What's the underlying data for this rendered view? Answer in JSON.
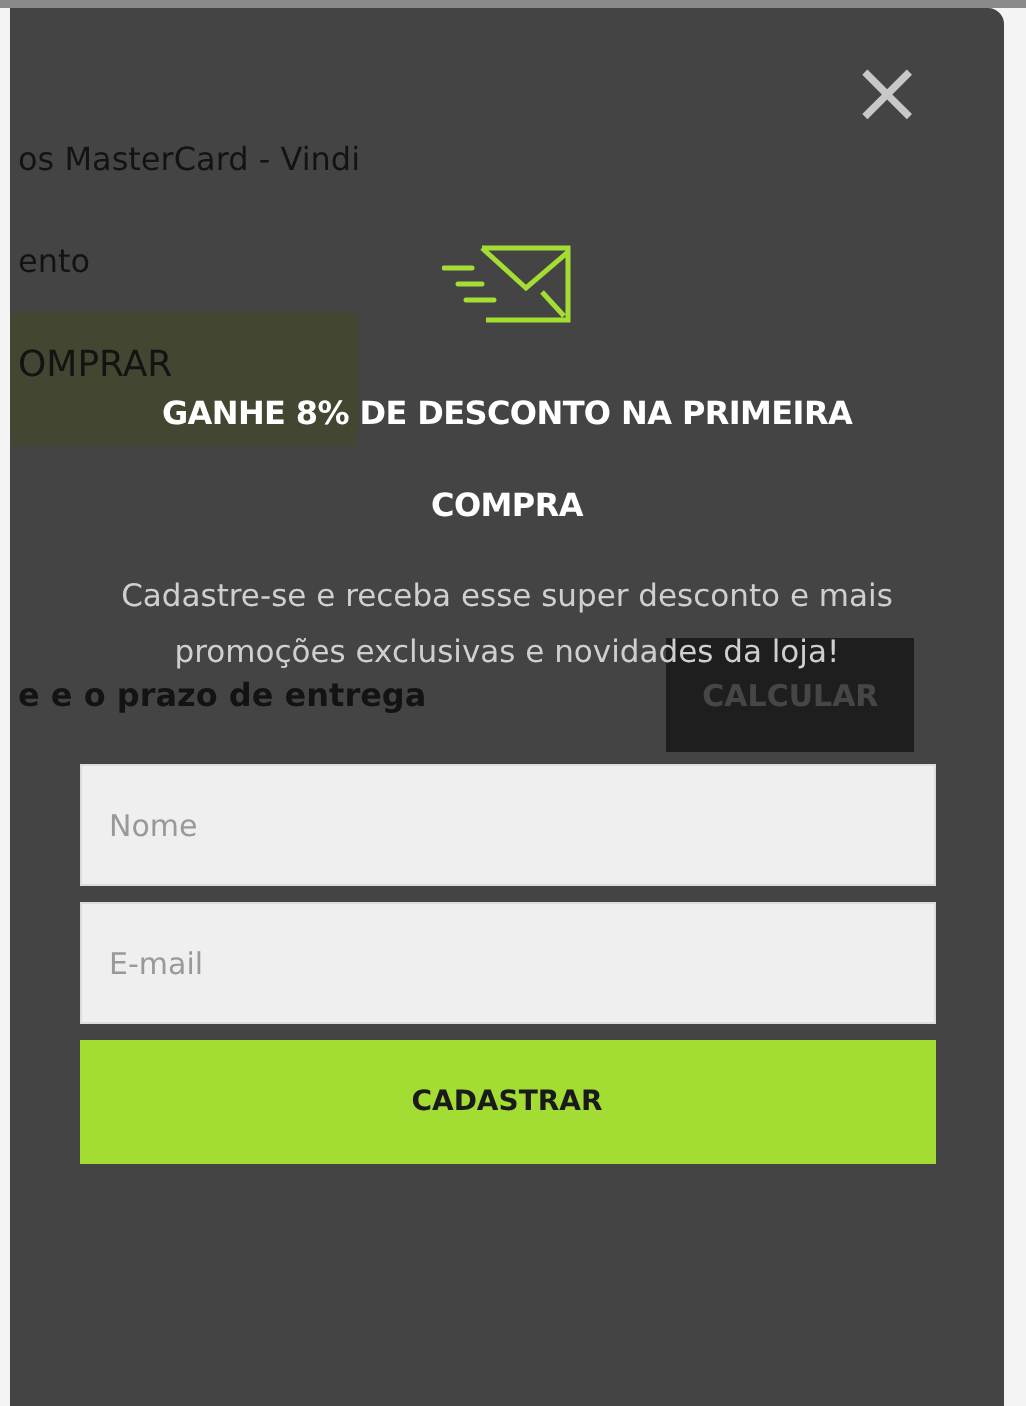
{
  "page_behind": {
    "product_title": "os MasterCard - Vindi",
    "label": "ento",
    "buy_button": "OMPRAR",
    "shipping_label": "e e o prazo de entrega",
    "calculate_button": "CALCULAR"
  },
  "popup": {
    "close": "×",
    "heading": "GANHE 8% DE DESCONTO NA PRIMEIRA COMPRA",
    "text": "Cadastre-se e receba esse super desconto e mais promoções exclusivas e novidades da loja!",
    "fields": [
      {
        "placeholder": "Nome"
      },
      {
        "placeholder": "E-mail"
      }
    ],
    "submit": "CADASTRAR"
  }
}
